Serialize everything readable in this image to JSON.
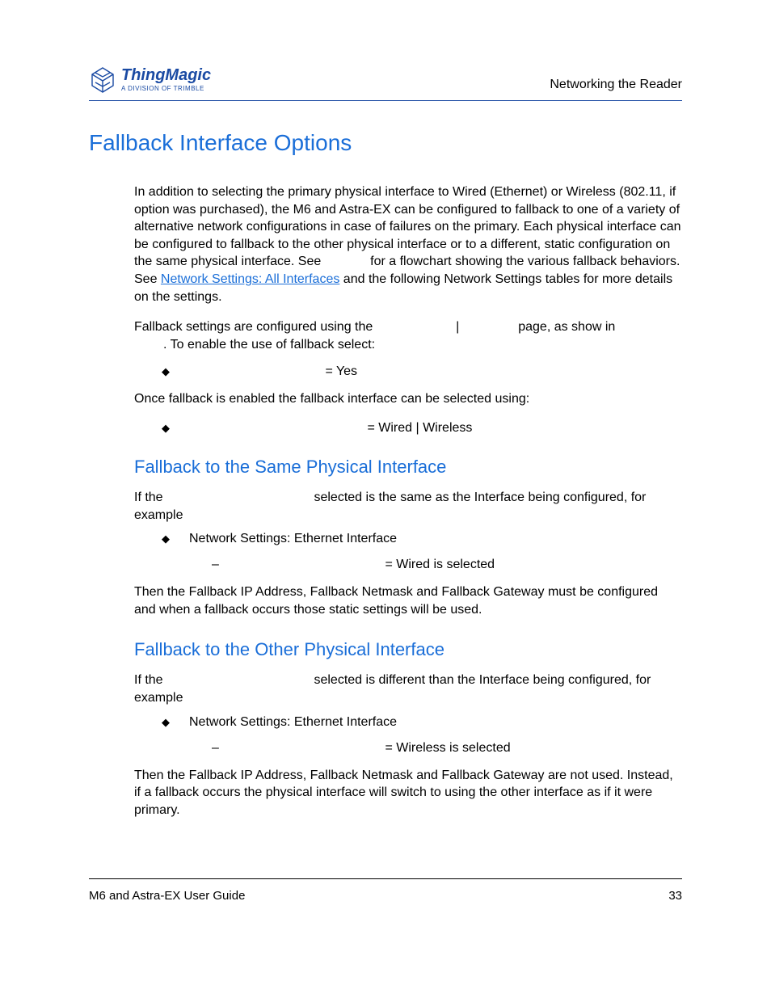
{
  "header": {
    "logo_brand": "ThingMagic",
    "logo_sub": "A DIVISION OF TRIMBLE",
    "right": "Networking the Reader"
  },
  "title": "Fallback Interface Options",
  "intro": {
    "p1a": "In addition to selecting the primary physical interface to Wired (Ethernet) or Wireless (802.11, if option was purchased), the M6 and Astra-EX can be configured to fallback to one of a variety of alternative network configurations in case of failures on the primary. Each physical interface can be configured to fallback to the other physical interface or to a different, static configuration on the same physical interface. See ",
    "p1b": " for a flowchart showing the various fallback behaviors. See ",
    "link1": "Network Settings: All Interfaces",
    "p1c": " and the following Network Settings tables for more details on the settings.",
    "p2a": "Fallback settings are configured using the ",
    "p2b": " | ",
    "p2c": " page, as show in ",
    "p2d": ". To enable the use of fallback select:"
  },
  "bullets": {
    "b1": " = Yes",
    "after_b1": "Once fallback is enabled the fallback interface can be selected using:",
    "b2": " = Wired | Wireless"
  },
  "same": {
    "heading": "Fallback to the Same Physical Interface",
    "p1a": "If the ",
    "p1b": " selected is the same as the Interface being configured, for example",
    "bullet": "Network Settings: Ethernet Interface",
    "sub": " = Wired is selected",
    "p2": "Then the Fallback IP Address, Fallback Netmask and Fallback Gateway must be configured and when a fallback occurs those static settings will be used."
  },
  "other": {
    "heading": "Fallback to the Other Physical Interface",
    "p1a": "If the ",
    "p1b": " selected is different than the Interface being configured, for example",
    "bullet": "Network Settings: Ethernet Interface",
    "sub": " = Wireless is selected",
    "p2": "Then the Fallback IP Address, Fallback Netmask and Fallback Gateway are not used. Instead, if a fallback occurs the physical interface will switch to using the other interface as if it were primary."
  },
  "footer": {
    "left": "M6 and Astra-EX User Guide",
    "right": "33"
  }
}
